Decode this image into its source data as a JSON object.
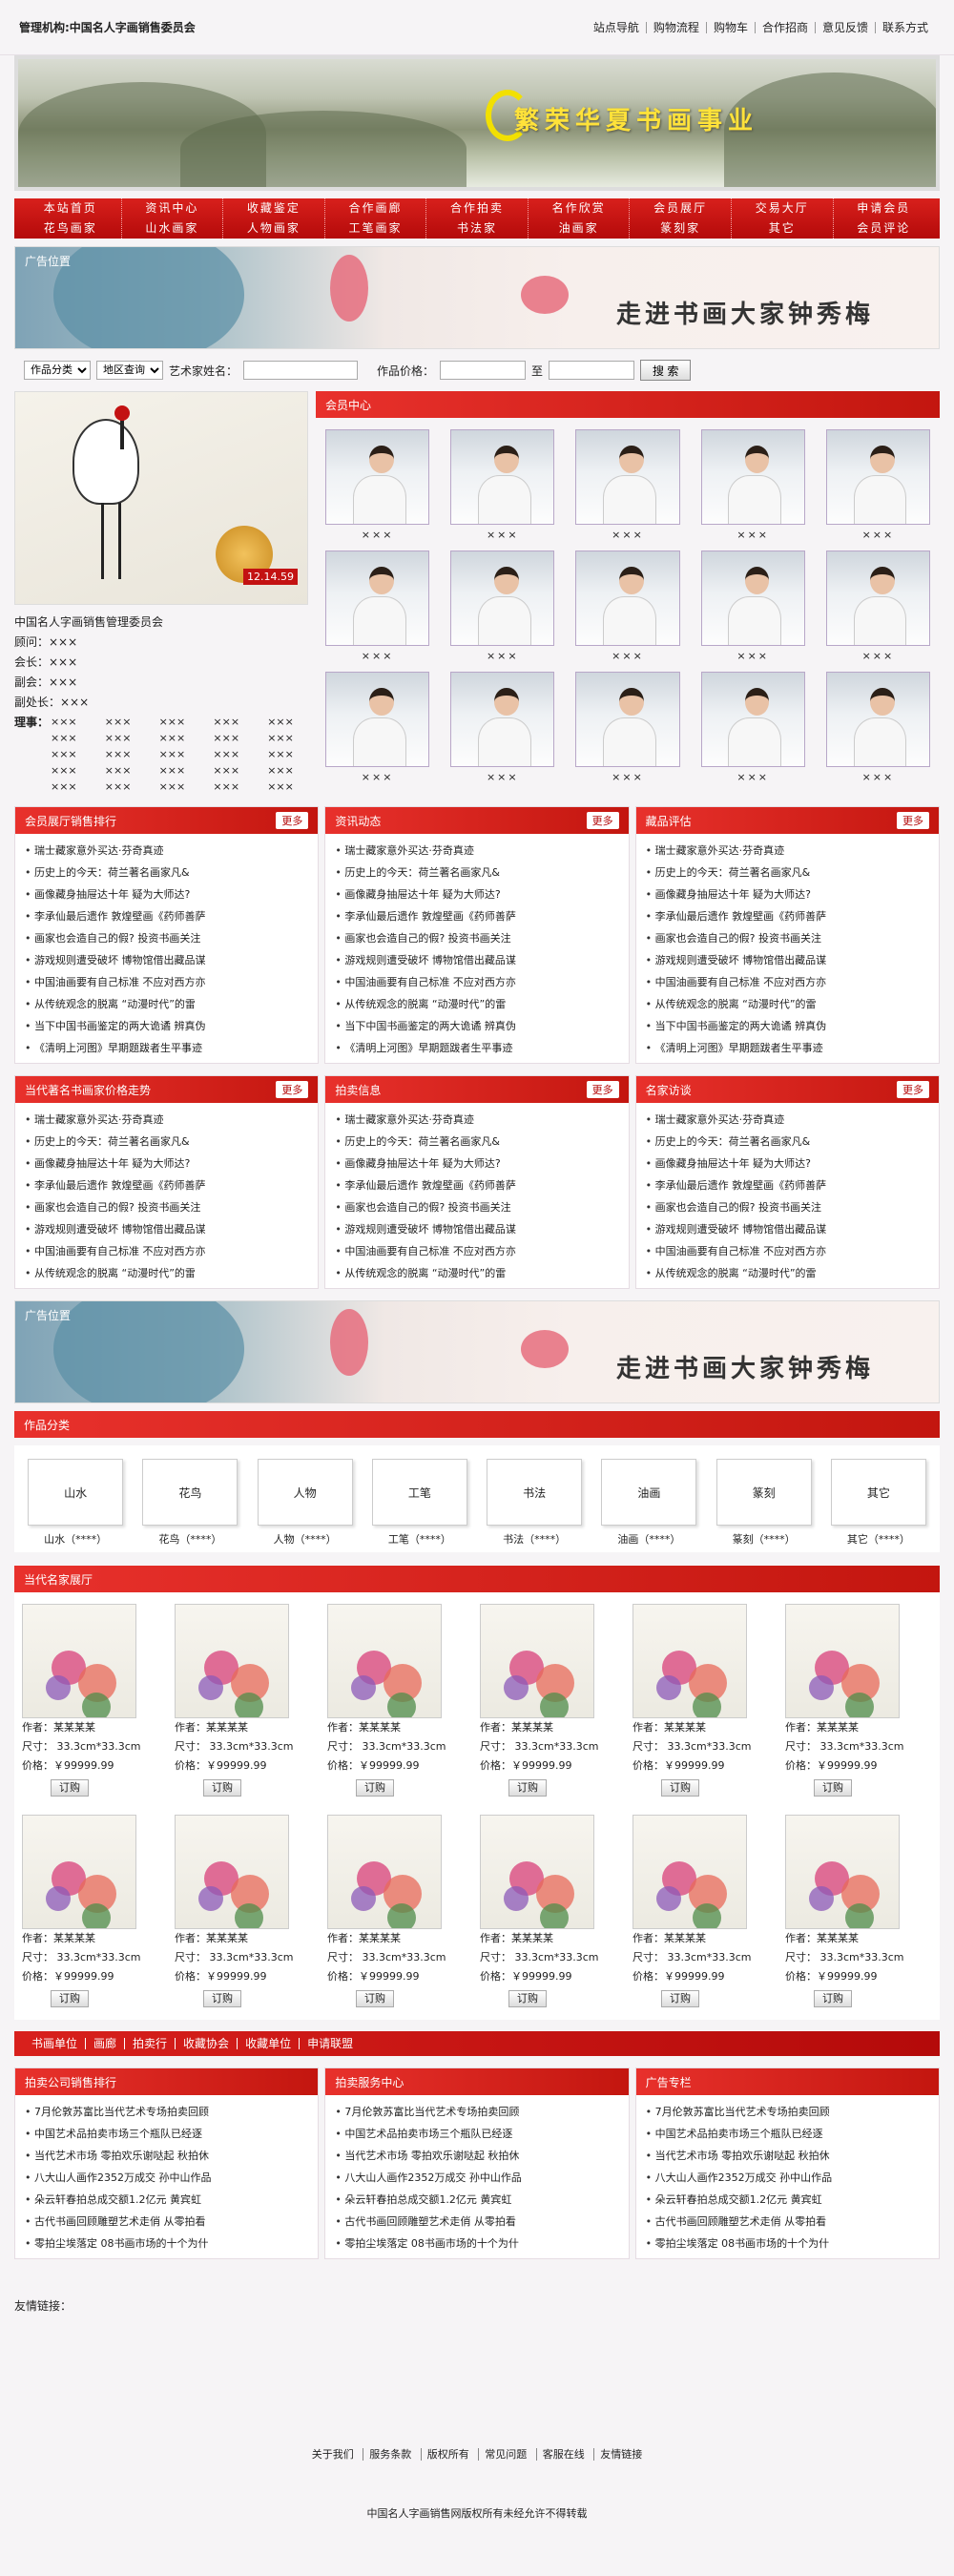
{
  "topbar": {
    "org": "管理机构:中国名人字画销售委员会",
    "links": [
      "站点导航",
      "购物流程",
      "购物车",
      "合作招商",
      "意见反馈",
      "联系方式"
    ]
  },
  "banner": {
    "title": "繁荣华夏书画事业"
  },
  "nav": {
    "row1": [
      "本站首页",
      "资讯中心",
      "收藏鉴定",
      "合作画廊",
      "合作拍卖",
      "名作欣赏",
      "会员展厅",
      "交易大厅",
      "申请会员"
    ],
    "row2": [
      "花鸟画家",
      "山水画家",
      "人物画家",
      "工笔画家",
      "书法家",
      "油画家",
      "篆刻家",
      "其它",
      "会员评论"
    ]
  },
  "hero1": {
    "label": "广告位置",
    "slogan": "走进书画大家钟秀梅"
  },
  "search": {
    "cat": "作品分类",
    "region": "地区查询",
    "artist_label": "艺术家姓名：",
    "price_label": "作品价格：",
    "to": "至",
    "btn": "搜 索"
  },
  "painting": {
    "date": "12.14.59"
  },
  "committee": {
    "title": "中国名人字画销售管理委员会",
    "adviser": "顾问：×××",
    "chair": "会长：×××",
    "vice": "副会：×××",
    "vice2": "副处长：×××",
    "director_label": "理事：",
    "directors": [
      "×××",
      "×××",
      "×××",
      "×××",
      "×××",
      "×××",
      "×××",
      "×××",
      "×××",
      "×××",
      "×××",
      "×××",
      "×××",
      "×××",
      "×××",
      "×××",
      "×××",
      "×××",
      "×××",
      "×××",
      "×××",
      "×××",
      "×××",
      "×××",
      "×××"
    ]
  },
  "members": {
    "title": "会员中心",
    "names": [
      "×××",
      "×××",
      "×××",
      "×××",
      "×××",
      "×××",
      "×××",
      "×××",
      "×××",
      "×××",
      "×××",
      "×××",
      "×××",
      "×××",
      "×××"
    ]
  },
  "news_items": [
    "瑞士藏家意外买达·芬奇真迹",
    "历史上的今天：荷兰著名画家凡&",
    "画像藏身抽屉达十年 疑为大师达?",
    "李承仙最后遗作 敦煌壁画《药师善萨",
    "画家也会造自己的假? 投资书画关注",
    "游戏规则遭受破坏 博物馆借出藏品谋",
    "中国油画要有自己标准 不应对西方亦",
    "从传统观念的脱离 “动漫时代”的雷",
    "当下中国书画鉴定的两大诡谲 辨真伪",
    "《清明上河图》早期题跋者生平事迹"
  ],
  "news_row1": [
    {
      "title": "会员展厅销售排行",
      "more": "更多"
    },
    {
      "title": "资讯动态",
      "more": "更多"
    },
    {
      "title": "藏品评估",
      "more": "更多"
    }
  ],
  "news_row2": [
    {
      "title": "当代著名书画家价格走势",
      "more": "更多"
    },
    {
      "title": "拍卖信息",
      "more": "更多"
    },
    {
      "title": "名家访谈",
      "more": "更多"
    }
  ],
  "hero2": {
    "label": "广告位置",
    "slogan": "走进书画大家钟秀梅"
  },
  "types": {
    "title": "作品分类",
    "items": [
      {
        "box": "山水",
        "cap": "山水（****）"
      },
      {
        "box": "花鸟",
        "cap": "花鸟（****）"
      },
      {
        "box": "人物",
        "cap": "人物（****）"
      },
      {
        "box": "工笔",
        "cap": "工笔（****）"
      },
      {
        "box": "书法",
        "cap": "书法（****）"
      },
      {
        "box": "油画",
        "cap": "油画（****）"
      },
      {
        "box": "篆刻",
        "cap": "篆刻（****）"
      },
      {
        "box": "其它",
        "cap": "其它（****）"
      }
    ]
  },
  "works": {
    "title": "当代名家展厅",
    "author": "作者：某某某某",
    "size": "尺寸： 33.3cm*33.3cm",
    "price": "价格：￥99999.99",
    "order": "订购"
  },
  "linkbar": [
    "书画单位",
    "画廊",
    "拍卖行",
    "收藏协会",
    "收藏单位",
    "申请联盟"
  ],
  "bottom_news": [
    {
      "title": "拍卖公司销售排行"
    },
    {
      "title": "拍卖服务中心"
    },
    {
      "title": "广告专栏"
    }
  ],
  "bottom_items": [
    "7月伦敦苏富比当代艺术专场拍卖回顾",
    "中国艺术品拍卖市场三个瓶队已经逐",
    "当代艺术市场 零拍欢乐谢哒起 秋拍休",
    "八大山人画作2352万成交 孙中山作品",
    "朵云轩春拍总成交额1.2亿元 黄宾虹",
    "古代书画回顾雕塑艺术走俏 从零拍看",
    "零拍尘埃落定 08书画市场的十个为什"
  ],
  "friend": {
    "label": "友情链接："
  },
  "footer": {
    "links": [
      "关于我们",
      "服务条款",
      "版权所有",
      "常见问题",
      "客服在线",
      "友情链接"
    ],
    "copy": "中国名人字画销售网版权所有未经允许不得转载"
  }
}
